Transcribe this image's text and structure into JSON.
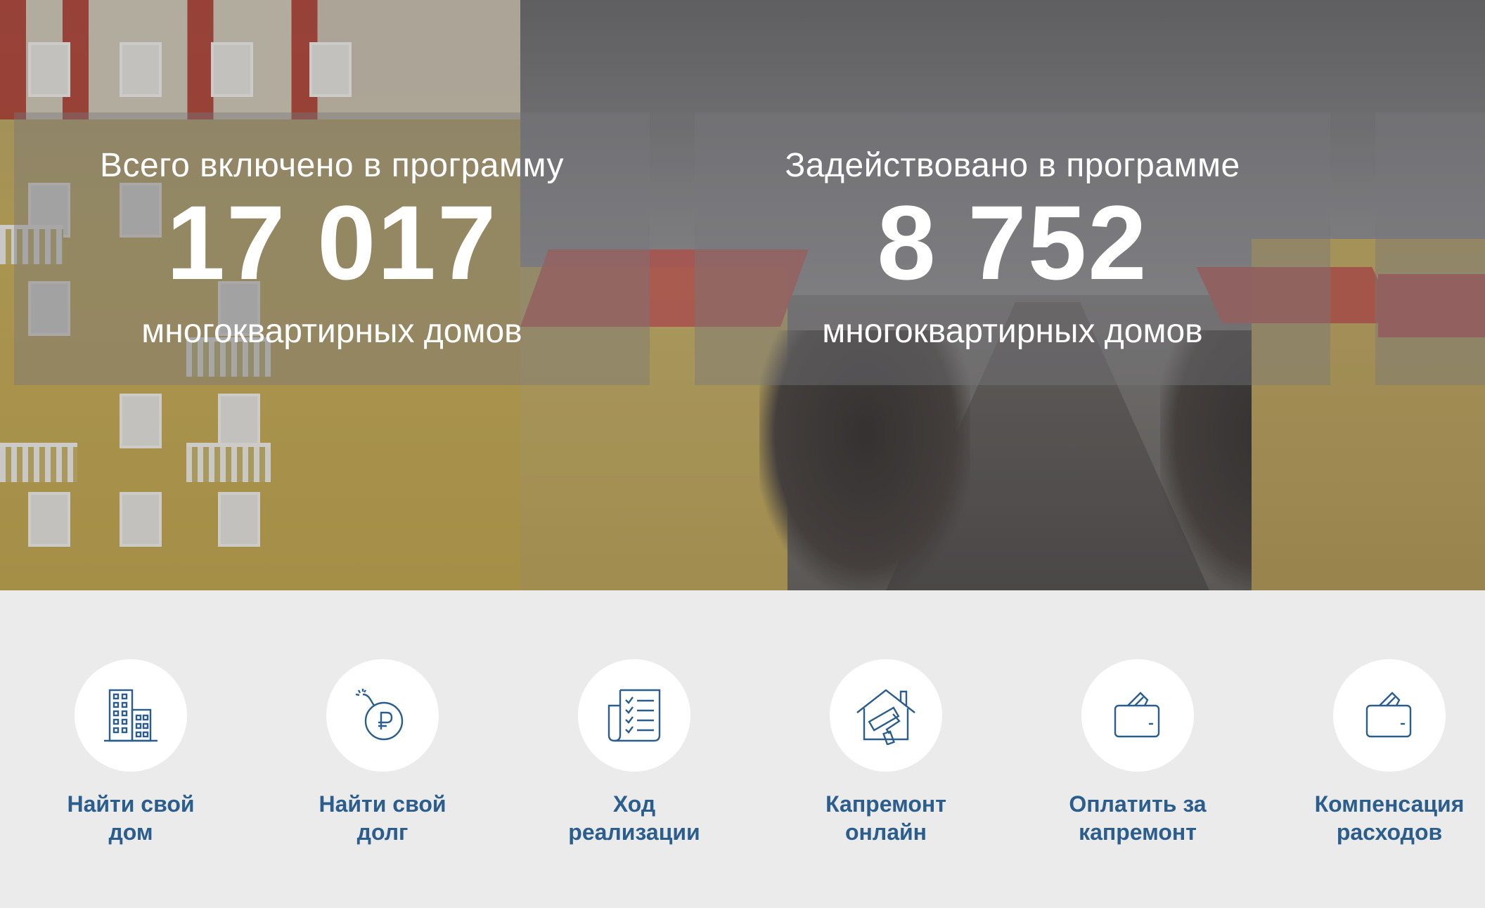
{
  "stats": [
    {
      "label": "Всего включено в программу",
      "value": "17 017",
      "unit": "многоквартирных домов"
    },
    {
      "label": "Задействовано в программе",
      "value": "8 752",
      "unit": "многоквартирных домов"
    }
  ],
  "nav": [
    {
      "icon": "building-icon",
      "label": "Найти свой\nдом"
    },
    {
      "icon": "bomb-ruble-icon",
      "label": "Найти свой\nдолг"
    },
    {
      "icon": "checklist-icon",
      "label": "Ход\nреализации"
    },
    {
      "icon": "house-paint-roller-icon",
      "label": "Капремонт\nонлайн"
    },
    {
      "icon": "wallet-card-icon",
      "label": "Оплатить за\nкапремонт"
    },
    {
      "icon": "wallet-icon",
      "label": "Компенсация\nрасходов"
    }
  ],
  "colors": {
    "accent": "#2b5d8d",
    "icon_stroke": "#2b5d8d",
    "nav_bg": "#ebebeb"
  }
}
